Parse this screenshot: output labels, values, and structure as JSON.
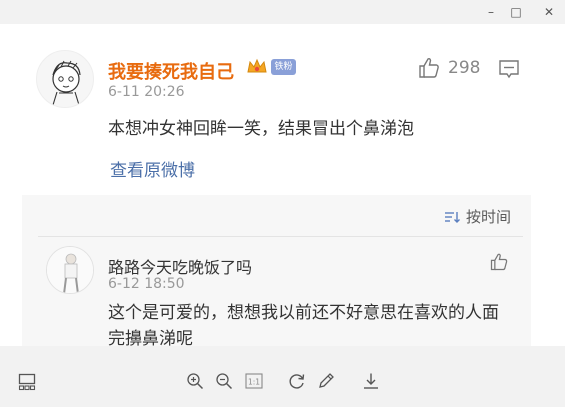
{
  "window": {
    "controls": {
      "minimize": "–",
      "maximize": "□",
      "close": "✕"
    }
  },
  "post": {
    "username": "我要揍死我自己",
    "badge": "铁粉",
    "timestamp": "6-11 20:26",
    "text": "本想冲女神回眸一笑，结果冒出个鼻涕泡",
    "view_original": "查看原微博",
    "like_count": "298"
  },
  "replies": {
    "sort_label": "按时间",
    "items": [
      {
        "username": "路路今天吃晚饭了吗",
        "timestamp": "6-12 18:50",
        "text": "这个是可爱的，想想我以前还不好意思在喜欢的人面完擤鼻涕呢"
      }
    ]
  },
  "toolbar": {
    "icons": [
      "thumbnail-icon",
      "zoom-in-icon",
      "zoom-out-icon",
      "actual-size-icon",
      "rotate-icon",
      "edit-icon",
      "download-icon"
    ],
    "actual_size_label": "1:1"
  },
  "colors": {
    "username": "#e86b0f",
    "link": "#4b6fa8",
    "badge": "#8aa0d8"
  }
}
